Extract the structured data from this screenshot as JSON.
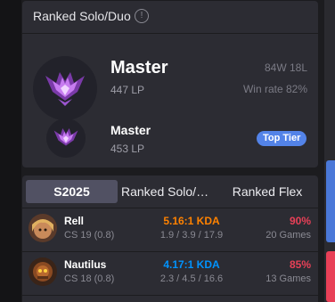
{
  "solo_card": {
    "title": "Ranked Solo/Duo",
    "info_glyph": "!",
    "tier": "Master",
    "lp": "447 LP",
    "record": "84W 18L",
    "win_rate": "Win rate 82%",
    "peak_tier": "Master",
    "peak_lp": "453 LP",
    "badge": "Top Tier",
    "colors": {
      "emblem": "#b45ee6",
      "badge": "#5383e8"
    }
  },
  "champ_card": {
    "tabs": [
      {
        "label": "S2025",
        "active": true
      },
      {
        "label": "Ranked Solo/D…",
        "active": false
      },
      {
        "label": "Ranked Flex",
        "active": false
      }
    ],
    "rows": [
      {
        "name": "Rell",
        "cs": "CS 19 (0.8)",
        "kda": "5.16:1 KDA",
        "kda_detail": "1.9 / 3.9 / 17.9",
        "win_rate": "90%",
        "games": "20 Games",
        "kda_color": "#ff8200",
        "wr_color": "#e84057",
        "avatar_icon": "rell-portrait"
      },
      {
        "name": "Nautilus",
        "cs": "CS 18 (0.8)",
        "kda": "4.17:1 KDA",
        "kda_detail": "2.3 / 4.5 / 16.6",
        "win_rate": "85%",
        "games": "13 Games",
        "kda_color": "#0093ff",
        "wr_color": "#e84057",
        "avatar_icon": "nautilus-portrait"
      }
    ]
  }
}
